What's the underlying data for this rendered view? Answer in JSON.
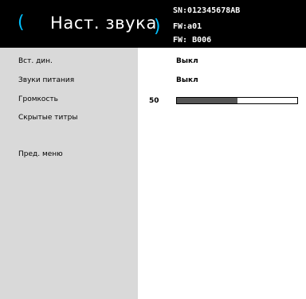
{
  "header": {
    "paren_left": "(",
    "title": "Наст. звука",
    "paren_right": ")",
    "serial": "SN:012345678AB",
    "firmware_1": "FW:a01",
    "firmware_2": "FW: B006"
  },
  "menu": {
    "items": [
      {
        "label": "Вст. дин.",
        "value": "Выкл"
      },
      {
        "label": "Звуки питания",
        "value": "Выкл"
      },
      {
        "label": "Громкость",
        "value": "50",
        "level": 0.5
      },
      {
        "label": "Скрытые титры",
        "value": ""
      }
    ],
    "prev_menu": "Пред. меню"
  },
  "colors": {
    "header_bg": "#000000",
    "accent": "#00c0ff",
    "panel_bg": "#d9d9d9",
    "slider_fill": "#555555"
  }
}
